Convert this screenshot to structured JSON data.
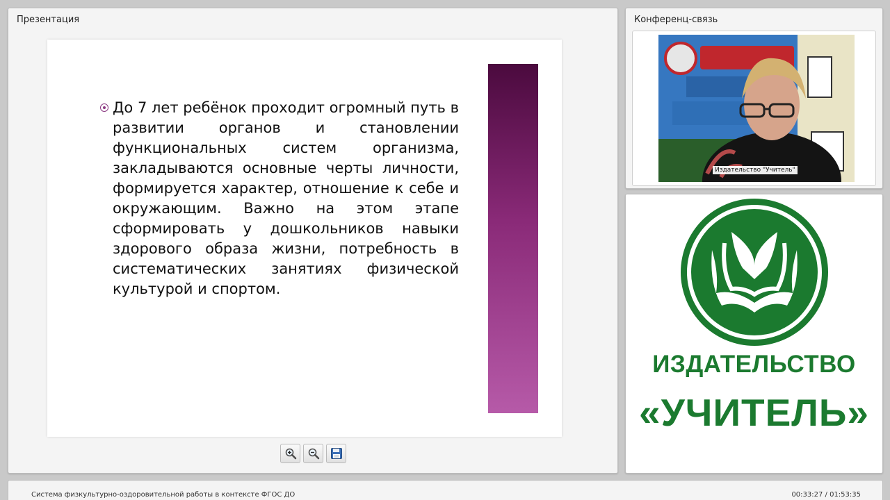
{
  "presentation": {
    "title": "Презентация",
    "slide_text": "До 7 лет ребёнок проходит огромный путь в развитии органов и становлении функциональных систем организма, закладываются основные черты личности, формируется характер, отношение к себе и окружающим. Важно на этом этапе сформировать у дошкольников навыки здорового образа жизни, потребность в систематических занятиях физической культурой и спортом.",
    "accent_color": "#8c3b83",
    "toolbar": [
      {
        "name": "zoom-in-button",
        "icon": "zoom-in-icon"
      },
      {
        "name": "zoom-out-button",
        "icon": "zoom-out-icon"
      },
      {
        "name": "save-button",
        "icon": "floppy-disk-icon"
      }
    ]
  },
  "conference": {
    "title": "Конференц-связь",
    "video_label": "Издательство \"Учитель\""
  },
  "logo": {
    "name_line": "ИЗДАТЕЛЬСТВО",
    "brand_line": "«УЧИТЕЛЬ»",
    "brand_color": "#1b7a2f"
  },
  "status": {
    "course_title": "Система физкультурно-оздоровительной работы в контексте ФГОС ДО",
    "time": "00:33:27 / 01:53:35"
  }
}
